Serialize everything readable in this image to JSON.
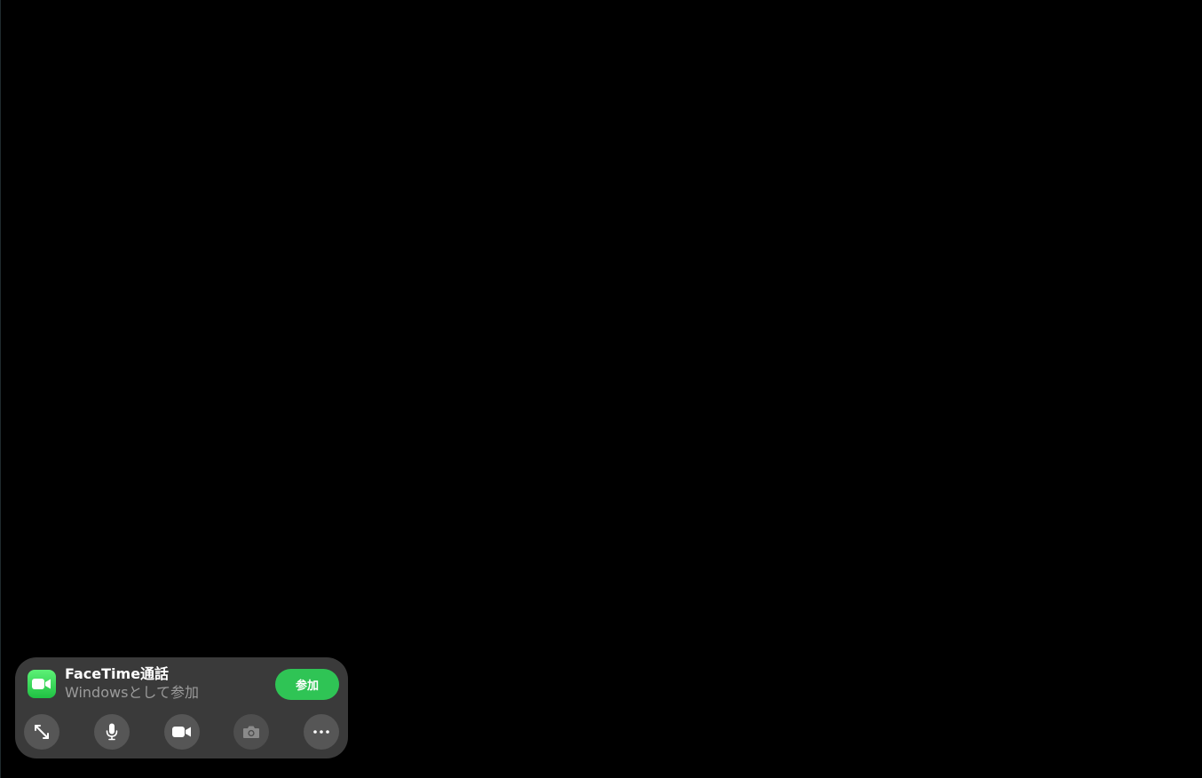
{
  "call": {
    "title": "FaceTime通話",
    "subtitle": "Windowsとして参加",
    "join_label": "参加",
    "app_icon": "facetime-video-icon"
  },
  "controls": [
    {
      "name": "expand",
      "icon": "expand-arrows-icon",
      "enabled": true
    },
    {
      "name": "microphone",
      "icon": "microphone-icon",
      "enabled": true
    },
    {
      "name": "camera",
      "icon": "video-camera-icon",
      "enabled": true
    },
    {
      "name": "photo",
      "icon": "photo-camera-icon",
      "enabled": false
    },
    {
      "name": "more",
      "icon": "ellipsis-icon",
      "enabled": true
    }
  ],
  "colors": {
    "background": "#000000",
    "panel": "#3a3a3a",
    "control": "#565656",
    "accent_green": "#2fc455",
    "subtitle_text": "#9b9b9b"
  }
}
